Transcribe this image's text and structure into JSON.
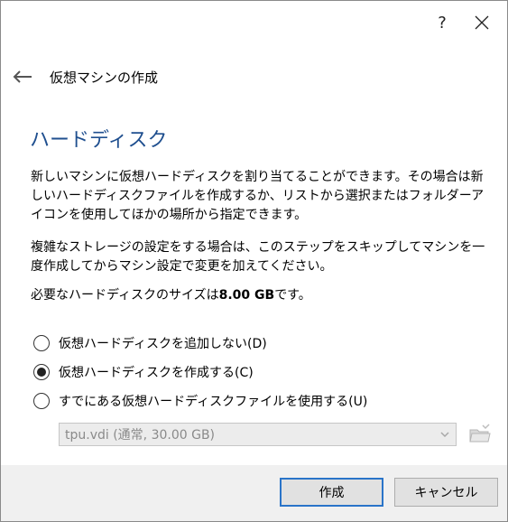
{
  "titlebar": {
    "help_label": "?"
  },
  "header": {
    "title": "仮想マシンの作成"
  },
  "page": {
    "heading": "ハードディスク"
  },
  "description": {
    "line1": "新しいマシンに仮想ハードディスクを割り当てることができます。その場合は新しいハードディスクファイルを作成するか、リストから選択またはフォルダーアイコンを使用してほかの場所から指定できます。",
    "line2": "複雑なストレージの設定をする場合は、このステップをスキップしてマシンを一度作成してからマシン設定で変更を加えてください。",
    "size_prefix": "必要なハードディスクのサイズは",
    "size_value": "8.00 GB",
    "size_suffix": "です。"
  },
  "options": [
    {
      "label": "仮想ハードディスクを追加しない(D)",
      "selected": false
    },
    {
      "label": "仮想ハードディスクを作成する(C)",
      "selected": true
    },
    {
      "label": "すでにある仮想ハードディスクファイルを使用する(U)",
      "selected": false
    }
  ],
  "existing_file": {
    "value": "tpu.vdi (通常, 30.00 GB)",
    "enabled": false
  },
  "buttons": {
    "create": "作成",
    "cancel": "キャンセル"
  },
  "colors": {
    "heading": "#1f4f8f",
    "default_button_border": "#2a74c9",
    "footer_bg": "#f0f0f0"
  }
}
